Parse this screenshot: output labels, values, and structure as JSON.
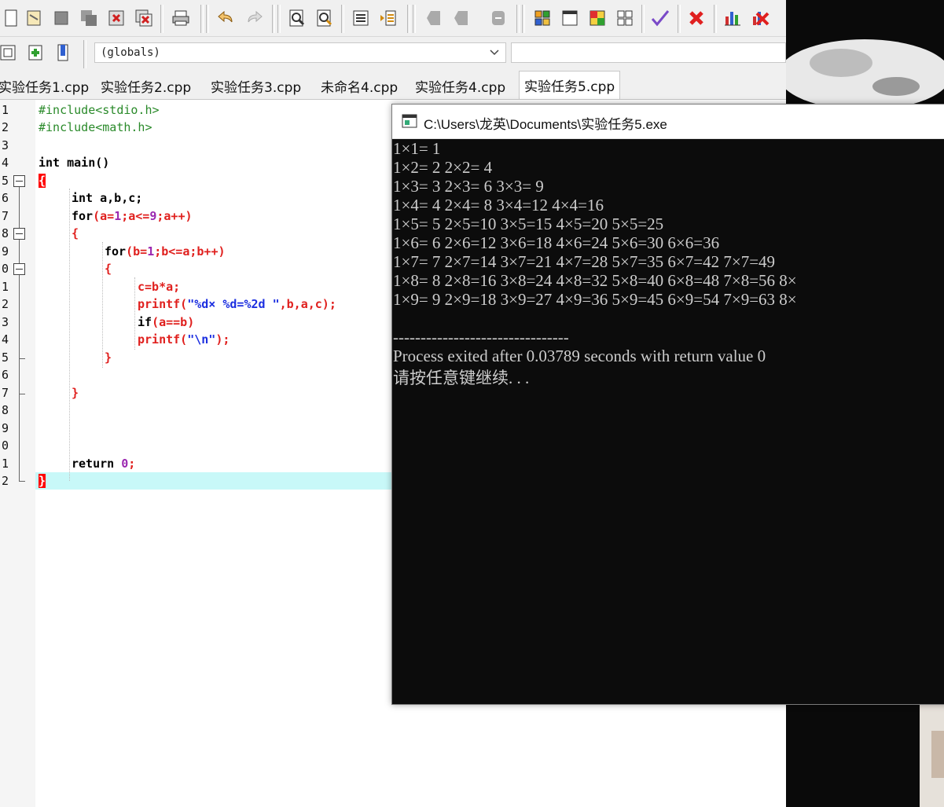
{
  "scope_select": {
    "value": "(globals)"
  },
  "tabs": [
    {
      "label": "实验任务1.cpp"
    },
    {
      "label": "实验任务2.cpp"
    },
    {
      "label": "实验任务3.cpp"
    },
    {
      "label": "未命名4.cpp"
    },
    {
      "label": "实验任务4.cpp"
    },
    {
      "label": "实验任务5.cpp",
      "active": true
    }
  ],
  "gutter": {
    "line_numbers": [
      "1",
      "2",
      "3",
      "4",
      "5",
      "6",
      "7",
      "8",
      "9",
      "0",
      "1",
      "2",
      "3",
      "4",
      "5",
      "6",
      "7",
      "8",
      "9",
      "0",
      "1",
      "2"
    ]
  },
  "code": {
    "line1": "#include<stdio.h>",
    "line2": "#include<math.h>",
    "line4_kw": "int",
    "line4_rest": " main()",
    "line5_brace": "{",
    "line6_kw": "int",
    "line6_rest": " a,b,c;",
    "line7_kw": "for",
    "line7_open": "(",
    "line7_a1": "a=",
    "line7_n1": "1",
    "line7_a2": ";a<=",
    "line7_n2": "9",
    "line7_a3": ";a++)",
    "line8_brace": "{",
    "line9_kw": "for",
    "line9_rest1": "(b=",
    "line9_n1": "1",
    "line9_rest2": ";b<=a;b++)",
    "line10_brace": "{",
    "line11": "c=b*a;",
    "line12_fn": "printf(",
    "line12_str": "\"%d× %d=%2d \"",
    "line12_rest": ",b,a,c);",
    "line13_kw": "if",
    "line13_rest": "(a==b)",
    "line14_fn": "printf(",
    "line14_str": "\"\\n\"",
    "line14_rest": ");",
    "line15_brace": "}",
    "line17_brace": "}",
    "line21_kw": "return",
    "line21_num": "0",
    "line21_rest": ";",
    "line22_brace": "}"
  },
  "console": {
    "title": "C:\\Users\\龙英\\Documents\\实验任务5.exe",
    "lines": [
      "1×1= 1",
      "1×2= 2 2×2= 4",
      "1×3= 3 2×3= 6 3×3= 9",
      "1×4= 4 2×4= 8 3×4=12 4×4=16",
      "1×5= 5 2×5=10 3×5=15 4×5=20 5×5=25",
      "1×6= 6 2×6=12 3×6=18 4×6=24 5×6=30 6×6=36",
      "1×7= 7 2×7=14 3×7=21 4×7=28 5×7=35 6×7=42 7×7=49",
      "1×8= 8 2×8=16 3×8=24 4×8=32 5×8=40 6×8=48 7×8=56 8×",
      "1×9= 9 2×9=18 3×9=27 4×9=36 5×9=45 6×9=54 7×9=63 8×",
      "",
      "--------------------------------",
      "Process exited after 0.03789 seconds with return value 0",
      "请按任意键继续. . ."
    ]
  },
  "colors": {
    "preprocessor": "#2a8a2a",
    "symbol": "#e0201e",
    "number": "#9b27b0",
    "string": "#1c2fe0",
    "current_line": "#c8f8f8",
    "console_bg": "#0c0c0c",
    "console_text": "#cccccc"
  }
}
